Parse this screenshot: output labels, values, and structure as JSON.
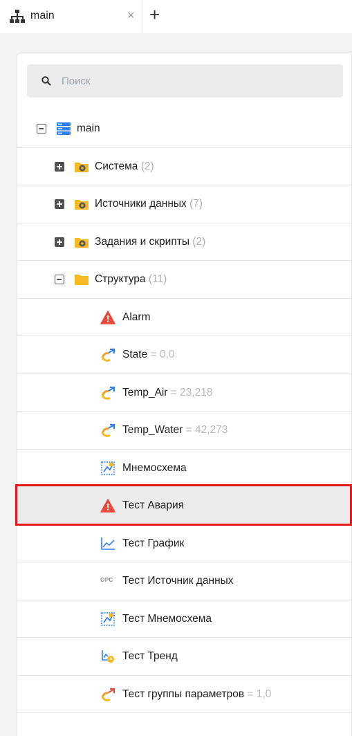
{
  "tab": {
    "label": "main",
    "close_glyph": "×",
    "add_glyph": "+",
    "icon": "sitemap-icon"
  },
  "search": {
    "placeholder": "Поиск",
    "value": ""
  },
  "tree": {
    "root": {
      "label": "main",
      "icon": "server-icon",
      "expanded": true
    },
    "folders": [
      {
        "label": "Система",
        "count": "(2)",
        "expanded": false,
        "icon": "folder-gear-icon"
      },
      {
        "label": "Источники данных",
        "count": "(7)",
        "expanded": false,
        "icon": "folder-gear-icon"
      },
      {
        "label": "Задания и скрипты",
        "count": "(2)",
        "expanded": false,
        "icon": "folder-gear-icon"
      },
      {
        "label": "Структура",
        "count": "(11)",
        "expanded": true,
        "icon": "folder-icon"
      }
    ],
    "items": [
      {
        "label": "Alarm",
        "value": "",
        "icon": "alarm-icon"
      },
      {
        "label": "State",
        "value": "= 0,0",
        "icon": "parameter-icon"
      },
      {
        "label": "Temp_Air",
        "value": "= 23,218",
        "icon": "parameter-icon"
      },
      {
        "label": "Temp_Water",
        "value": "= 42,273",
        "icon": "parameter-icon"
      },
      {
        "label": "Мнемосхема",
        "value": "",
        "icon": "mnemoscheme-icon"
      },
      {
        "label": "Тест Авария",
        "value": "",
        "icon": "alarm-icon",
        "selected": true
      },
      {
        "label": "Тест График",
        "value": "",
        "icon": "chart-icon"
      },
      {
        "label": "Тест Источник данных",
        "value": "",
        "icon": "opc-icon"
      },
      {
        "label": "Тест Мнемосхема",
        "value": "",
        "icon": "mnemoscheme-icon"
      },
      {
        "label": "Тест Тренд",
        "value": "",
        "icon": "trend-icon"
      },
      {
        "label": "Тест группы параметров",
        "value": "= 1,0",
        "icon": "parameter-icon"
      }
    ],
    "opc_text": "OPC"
  },
  "colors": {
    "selection_outline": "#e8161a",
    "folder": "#f5b922",
    "server": "#2f80ed",
    "alarm": "#e94b3c"
  }
}
